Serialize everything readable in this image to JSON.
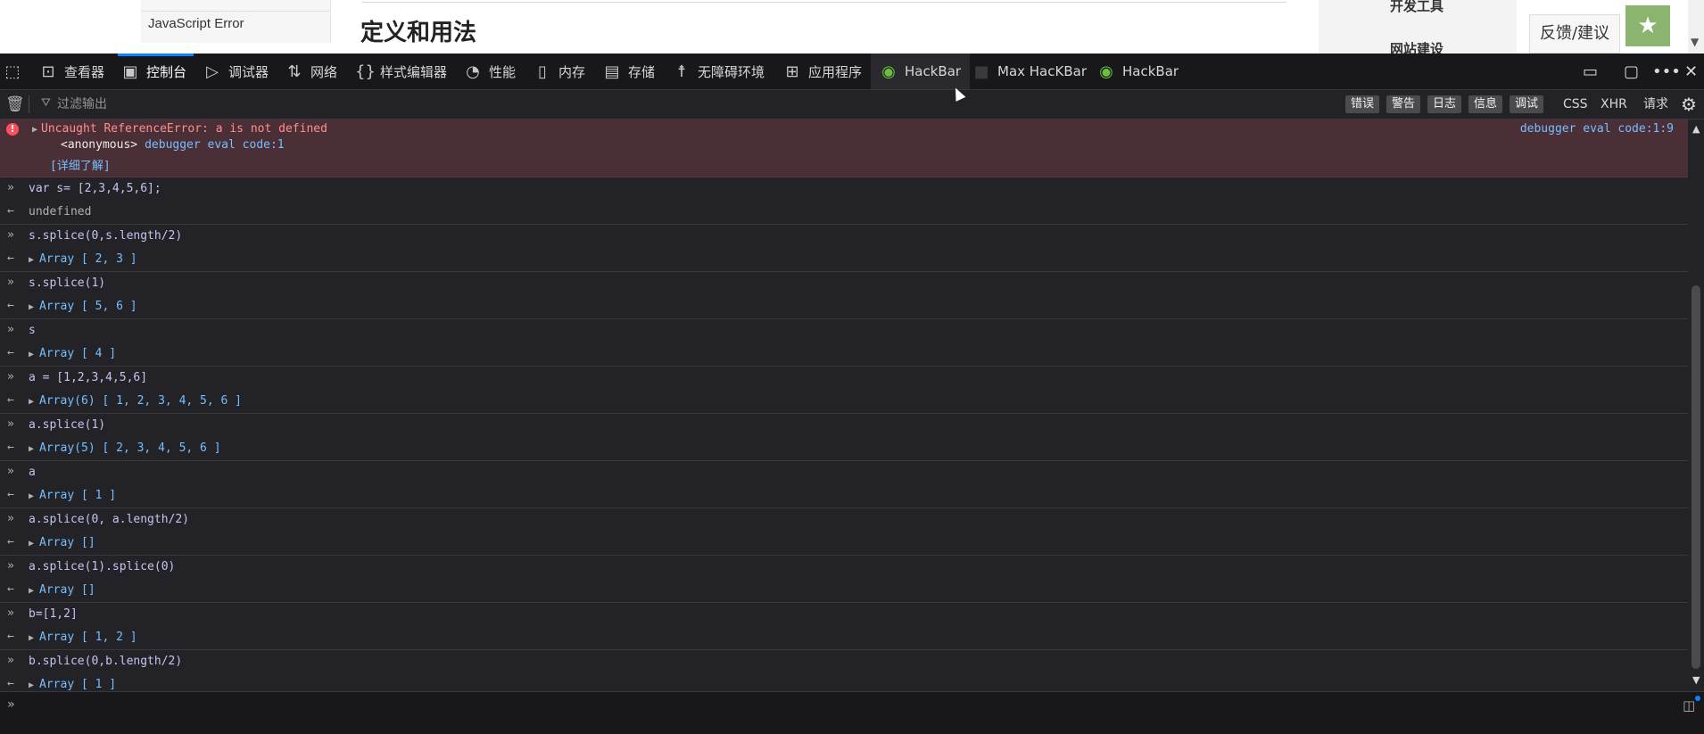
{
  "webpage": {
    "sidebar_item": "JavaScript Error",
    "heading": "定义和用法",
    "right_link_1": "开发工具",
    "right_link_2": "网站建设",
    "feedback": "反馈/建议"
  },
  "toolbar": {
    "tabs": [
      {
        "label": "查看器",
        "icon": "inspector-icon"
      },
      {
        "label": "控制台",
        "icon": "console-icon"
      },
      {
        "label": "调试器",
        "icon": "debugger-icon"
      },
      {
        "label": "网络",
        "icon": "network-icon"
      },
      {
        "label": "样式编辑器",
        "icon": "style-editor-icon"
      },
      {
        "label": "性能",
        "icon": "performance-icon"
      },
      {
        "label": "内存",
        "icon": "memory-icon"
      },
      {
        "label": "存储",
        "icon": "storage-icon"
      },
      {
        "label": "无障碍环境",
        "icon": "accessibility-icon"
      },
      {
        "label": "应用程序",
        "icon": "application-icon"
      },
      {
        "label": "HackBar",
        "icon": "hackbar-icon"
      },
      {
        "label": "Max HacKBar",
        "icon": "lock-icon"
      },
      {
        "label": "HackBar",
        "icon": "hackbar-icon"
      }
    ],
    "active_tab": "控制台"
  },
  "filter": {
    "placeholder": "过滤输出",
    "levels": [
      "错误",
      "警告",
      "日志",
      "信息",
      "调试"
    ],
    "types": [
      "CSS",
      "XHR",
      "请求"
    ]
  },
  "error": {
    "message": "Uncaught ReferenceError: a is not defined",
    "frame_name": "<anonymous>",
    "frame_location": "debugger eval code:1",
    "learn_more": "[详细了解]",
    "location": "debugger eval code:1:9"
  },
  "entries": [
    {
      "input": "var s= [2,3,4,5,6];",
      "output": "undefined",
      "is_object": false
    },
    {
      "input": "s.splice(0,s.length/2)",
      "output": "Array [ 2, 3 ]",
      "is_object": true
    },
    {
      "input": "s.splice(1)",
      "output": "Array [ 5, 6 ]",
      "is_object": true
    },
    {
      "input": "s",
      "output": "Array [ 4 ]",
      "is_object": true
    },
    {
      "input": "a = [1,2,3,4,5,6]",
      "output": "Array(6) [ 1, 2, 3, 4, 5, 6 ]",
      "is_object": true
    },
    {
      "input": "a.splice(1)",
      "output": "Array(5) [ 2, 3, 4, 5, 6 ]",
      "is_object": true
    },
    {
      "input": "a",
      "output": "Array [ 1 ]",
      "is_object": true
    },
    {
      "input": "a.splice(0, a.length/2)",
      "output": "Array []",
      "is_object": true
    },
    {
      "input": "a.splice(1).splice(0)",
      "output": "Array []",
      "is_object": true
    },
    {
      "input": "b=[1,2]",
      "output": "Array [ 1, 2 ]",
      "is_object": true
    },
    {
      "input": "b.splice(0,b.length/2)",
      "output": "Array [ 1 ]",
      "is_object": true
    }
  ],
  "prompts": {
    "input_prefix": "»",
    "output_prefix": "←"
  }
}
